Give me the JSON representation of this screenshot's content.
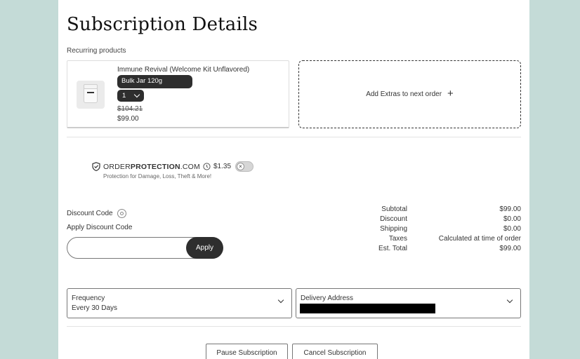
{
  "page": {
    "title": "Subscription Details",
    "recurring_label": "Recurring products"
  },
  "product": {
    "name": "Immune Revival (Welcome Kit Unflavored)",
    "variant": "Bulk Jar 120g",
    "quantity": "1",
    "old_price": "$104.21",
    "price": "$99.00",
    "thumb_icon": "product-jar-icon"
  },
  "extras": {
    "label": "Add Extras to next order",
    "icon": "plus-icon"
  },
  "order_protection": {
    "logo_light": "ORDER",
    "logo_bold": "PROTECTION",
    "logo_suffix": ".COM",
    "price": "$1.35",
    "subtitle": "Protection for Damage, Loss, Theft & More!",
    "enabled": false
  },
  "discount": {
    "label": "Discount Code",
    "apply_label": "Apply Discount Code",
    "input_value": "",
    "apply_button": "Apply"
  },
  "summary": {
    "rows": [
      {
        "label": "Subtotal",
        "value": "$99.00"
      },
      {
        "label": "Discount",
        "value": "$0.00"
      },
      {
        "label": "Shipping",
        "value": "$0.00"
      },
      {
        "label": "Taxes",
        "value": "Calculated at time of order"
      },
      {
        "label": "Est. Total",
        "value": "$99.00"
      }
    ]
  },
  "frequency": {
    "label": "Frequency",
    "value": "Every 30 Days"
  },
  "delivery": {
    "label": "Delivery Address"
  },
  "actions": {
    "pause": "Pause Subscription",
    "cancel": "Cancel Subscription"
  },
  "colors": {
    "background": "#c4dbd7",
    "panel": "#ffffff",
    "dark_button": "#2e2e2e"
  }
}
